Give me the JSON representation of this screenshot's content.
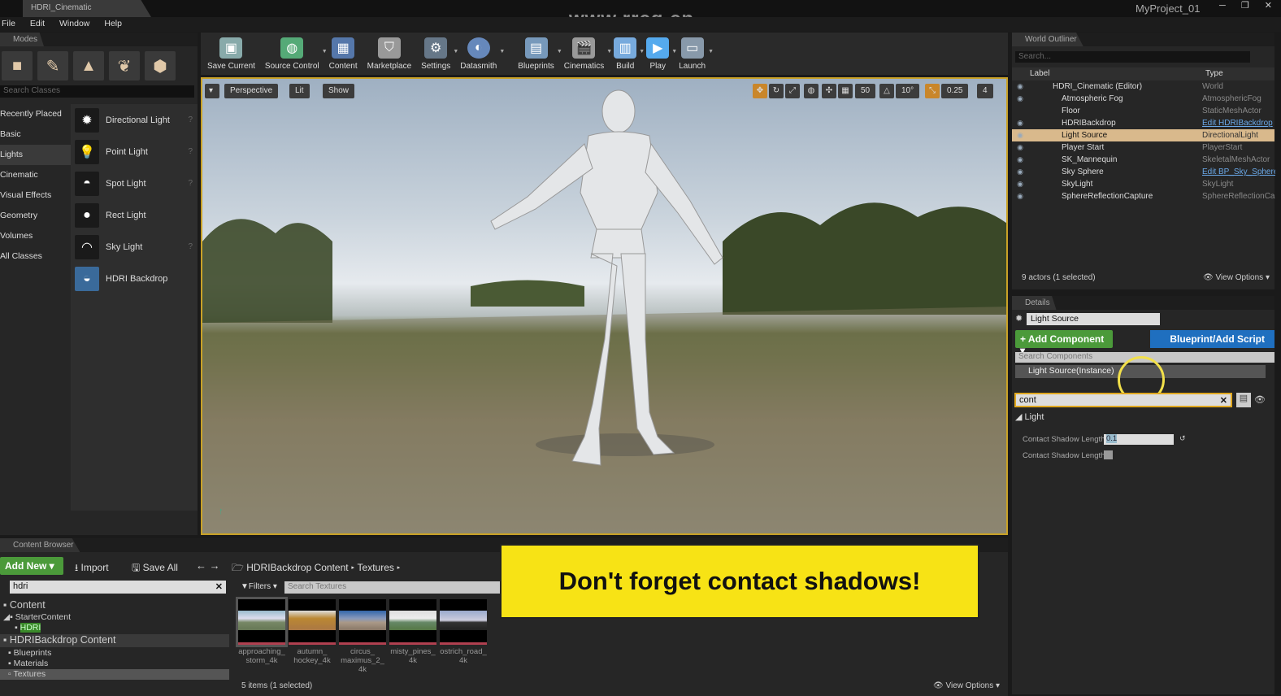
{
  "window": {
    "doc_tab": "HDRI_Cinematic",
    "project": "MyProject_01",
    "watermark": "www.rrcg.cn",
    "controls": "─ ❐ ✕"
  },
  "menu": [
    "File",
    "Edit",
    "Window",
    "Help"
  ],
  "modes": {
    "tab": "Modes",
    "search_placeholder": "Search Classes",
    "categories": [
      "Recently Placed",
      "Basic",
      "Lights",
      "Cinematic",
      "Visual Effects",
      "Geometry",
      "Volumes",
      "All Classes"
    ],
    "selected_category": "Lights",
    "items": [
      "Directional Light",
      "Point Light",
      "Spot Light",
      "Rect Light",
      "Sky Light",
      "HDRI Backdrop"
    ]
  },
  "toolbar": [
    "Save Current",
    "Source Control",
    "Content",
    "Marketplace",
    "Settings",
    "Datasmith",
    "Blueprints",
    "Cinematics",
    "Build",
    "Play",
    "Launch"
  ],
  "viewport": {
    "perspective": "Perspective",
    "lit": "Lit",
    "show": "Show",
    "grid_snap": "50",
    "rot_snap": "10°",
    "scale_snap": "0.25",
    "cam_speed": "4"
  },
  "outliner": {
    "tab": "World Outliner",
    "search_placeholder": "Search...",
    "col_label": "Label",
    "col_type": "Type",
    "rows": [
      {
        "label": "HDRI_Cinematic (Editor)",
        "type": "World",
        "link": false
      },
      {
        "label": "Atmospheric Fog",
        "type": "AtmosphericFog",
        "link": false
      },
      {
        "label": "Floor",
        "type": "StaticMeshActor",
        "link": false
      },
      {
        "label": "HDRIBackdrop",
        "type": "Edit HDRIBackdrop",
        "link": true
      },
      {
        "label": "Light Source",
        "type": "DirectionalLight",
        "link": false,
        "selected": true
      },
      {
        "label": "Player Start",
        "type": "PlayerStart",
        "link": false
      },
      {
        "label": "SK_Mannequin",
        "type": "SkeletalMeshActor",
        "link": false
      },
      {
        "label": "Sky Sphere",
        "type": "Edit BP_Sky_Sphere",
        "link": true
      },
      {
        "label": "SkyLight",
        "type": "SkyLight",
        "link": false
      },
      {
        "label": "SphereReflectionCapture",
        "type": "SphereReflectionCapture",
        "link": false
      }
    ],
    "status": "9 actors (1 selected)",
    "view_options": "View Options"
  },
  "details": {
    "tab": "Details",
    "name": "Light Source",
    "add_component": "+ Add Component",
    "blueprint": "Blueprint/Add Script",
    "search_components": "Search Components",
    "instance": "Light Source(Instance)",
    "filter": "cont",
    "section": "Light",
    "props": [
      {
        "label": "Contact Shadow Length",
        "value": "0.1"
      },
      {
        "label": "Contact Shadow Length",
        "value": ""
      }
    ]
  },
  "content_browser": {
    "tab": "Content Browser",
    "add_new": "Add New",
    "import": "Import",
    "save_all": "Save All",
    "path": [
      "HDRIBackdrop Content",
      "Textures"
    ],
    "search": "hdri",
    "filters": "Filters",
    "search_placeholder": "Search Textures",
    "tree": [
      "Content",
      "StarterContent",
      "HDRI",
      "HDRIBackdrop Content",
      "Blueprints",
      "Materials",
      "Textures"
    ],
    "assets": [
      "approaching_ storm_4k",
      "autumn_ hockey_4k",
      "circus_ maximus_2_ 4k",
      "misty_pines_ 4k",
      "ostrich_road_ 4k"
    ],
    "status": "5 items (1 selected)",
    "view_options": "View Options"
  },
  "banner": "Don't forget contact shadows!",
  "colors": {
    "accent": "#c9a227",
    "green": "#4b9a3a",
    "blue": "#1f6fbf",
    "selection": "#d9b98c",
    "banner": "#f7e315"
  }
}
